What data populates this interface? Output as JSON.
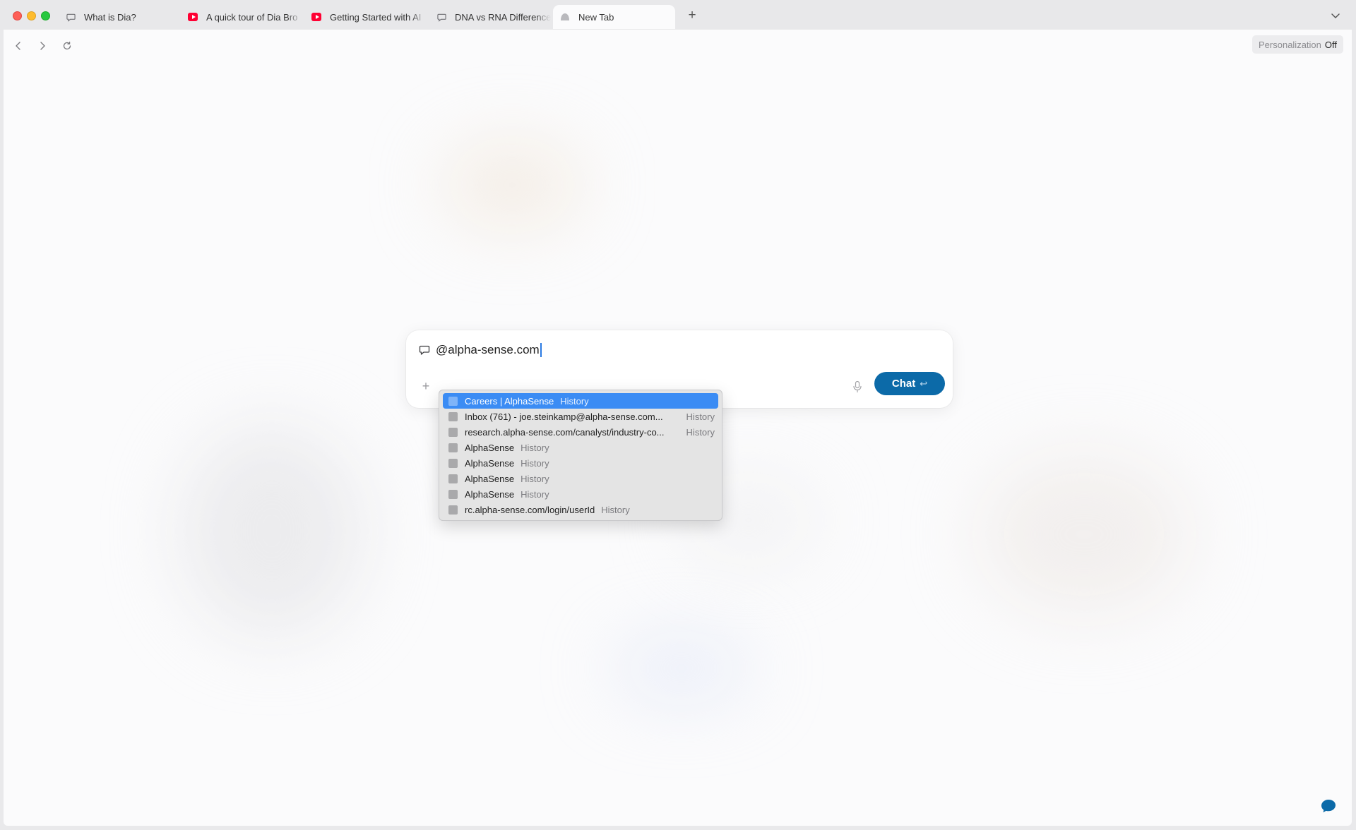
{
  "tabs": [
    {
      "title": "What is Dia?",
      "icon": "chat-bubble-icon"
    },
    {
      "title": "A quick tour of Dia Bro",
      "icon": "youtube-icon"
    },
    {
      "title": "Getting Started with AI",
      "icon": "youtube-icon"
    },
    {
      "title": "DNA vs RNA Difference",
      "icon": "chat-bubble-icon"
    },
    {
      "title": "New Tab",
      "icon": "dia-icon",
      "active": true
    }
  ],
  "new_tab_label": "+",
  "personalization": {
    "label": "Personalization",
    "state": "Off"
  },
  "chat": {
    "query": "@alpha-sense.com",
    "submit_label": "Chat",
    "submit_hint": "↩"
  },
  "suggestions": [
    {
      "title": "Careers | AlphaSense",
      "source": "History",
      "selected": true
    },
    {
      "title": "Inbox (761) - joe.steinkamp@alpha-sense.com...",
      "source": "History"
    },
    {
      "title": "research.alpha-sense.com/canalyst/industry-co...",
      "source": "History"
    },
    {
      "title": "AlphaSense",
      "source": "History"
    },
    {
      "title": "AlphaSense",
      "source": "History"
    },
    {
      "title": "AlphaSense",
      "source": "History"
    },
    {
      "title": "AlphaSense",
      "source": "History"
    },
    {
      "title": "rc.alpha-sense.com/login/userId",
      "source": "History"
    }
  ],
  "colors": {
    "accent": "#0c6aa8",
    "selection": "#3b8cf4",
    "youtube": "#ff0033"
  }
}
